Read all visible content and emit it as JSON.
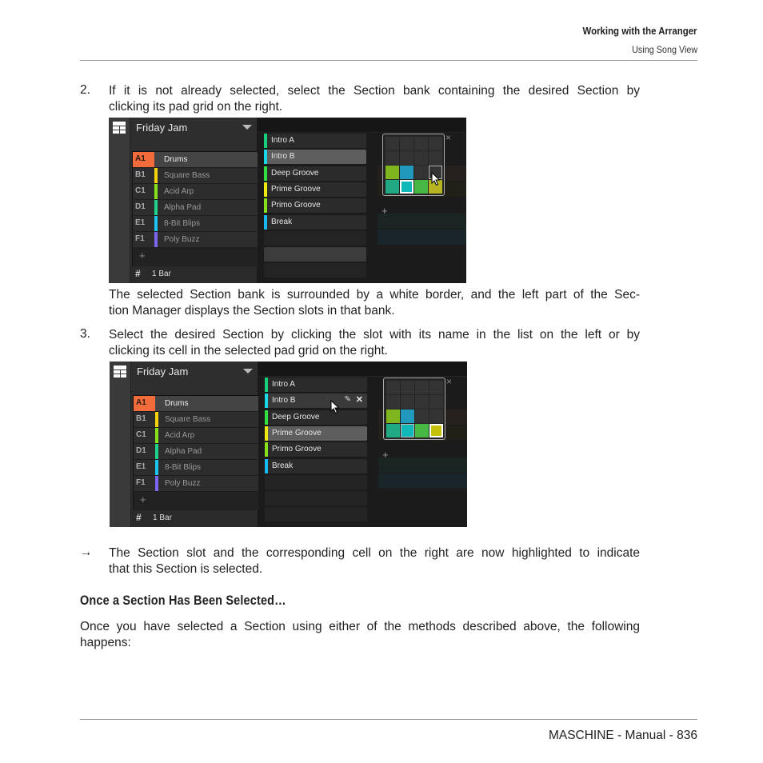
{
  "header": {
    "chapter": "Working with the Arranger",
    "section": "Using Song View"
  },
  "steps": [
    {
      "number": "2.",
      "lines": [
        "If it is not already selected, select the Section bank containing the desired Section by",
        "clicking its pad grid on the right."
      ]
    },
    {
      "number": "3.",
      "lines": [
        "Select the desired Section by clicking the slot with its name in the list on the left or by",
        "clicking its cell in the selected pad grid on the right."
      ]
    }
  ],
  "note_after_step2": [
    "The selected Section bank is surrounded by a white border, and the left part of the Sec-",
    "tion Manager displays the Section slots in that bank."
  ],
  "result": {
    "arrow": "→",
    "lines": [
      "The Section slot and the corresponding cell on the right are now highlighted to indicate",
      "that this Section is selected."
    ]
  },
  "subheading": "Once a Section Has Been Selected…",
  "closing": [
    "Once you have selected a Section using either of the methods described above, the following",
    "happens:"
  ],
  "footer": "MASCHINE - Manual - 836",
  "screenshots": [
    {
      "song_title": "Friday Jam",
      "bar_setting": "1 Bar",
      "add_label": "+",
      "groups": [
        {
          "id": "A1",
          "name": "Drums",
          "color": "#f26b3a",
          "selected": true
        },
        {
          "id": "B1",
          "name": "Square Bass",
          "color": "#f5d20a"
        },
        {
          "id": "C1",
          "name": "Acid Arp",
          "color": "#86e01a"
        },
        {
          "id": "D1",
          "name": "Alpha Pad",
          "color": "#1fd18a"
        },
        {
          "id": "E1",
          "name": "8-Bit Blips",
          "color": "#1cc4f0"
        },
        {
          "id": "F1",
          "name": "Poly Buzz",
          "color": "#7a66f0"
        }
      ],
      "sections": [
        {
          "name": "Intro A",
          "color": "#18d07a"
        },
        {
          "name": "Intro B",
          "color": "#18d8e8",
          "highlighted": true
        },
        {
          "name": "Deep Groove",
          "color": "#30e040"
        },
        {
          "name": "Prime Groove",
          "color": "#f0ea10"
        },
        {
          "name": "Primo Groove",
          "color": "#86e01a"
        },
        {
          "name": "Break",
          "color": "#18b8f0"
        }
      ],
      "pad_grid": {
        "rows": [
          [
            "#333333",
            "#333333",
            "#333333",
            "#333333"
          ],
          [
            "#333333",
            "#333333",
            "#333333",
            "#333333"
          ],
          [
            "#7fb61f",
            "#2199bc",
            "#333333",
            "#333333"
          ],
          [
            "#20a983",
            "#10b8b8",
            "#46b843",
            "#b6b421"
          ]
        ],
        "selected_cell": [
          3,
          1
        ],
        "hover_cell": [
          2,
          3
        ]
      },
      "close_icon": "×",
      "add_bank_icon": "+"
    },
    {
      "song_title": "Friday Jam",
      "bar_setting": "1 Bar",
      "add_label": "+",
      "groups": [
        {
          "id": "A1",
          "name": "Drums",
          "color": "#f26b3a",
          "selected": true
        },
        {
          "id": "B1",
          "name": "Square Bass",
          "color": "#f5d20a"
        },
        {
          "id": "C1",
          "name": "Acid Arp",
          "color": "#86e01a"
        },
        {
          "id": "D1",
          "name": "Alpha Pad",
          "color": "#1fd18a"
        },
        {
          "id": "E1",
          "name": "8-Bit Blips",
          "color": "#1cc4f0"
        },
        {
          "id": "F1",
          "name": "Poly Buzz",
          "color": "#7a66f0"
        }
      ],
      "sections": [
        {
          "name": "Intro A",
          "color": "#18d07a"
        },
        {
          "name": "Intro B",
          "color": "#18d8e8",
          "hover": true
        },
        {
          "name": "Deep Groove",
          "color": "#30e040"
        },
        {
          "name": "Prime Groove",
          "color": "#f0ea10",
          "highlighted": true
        },
        {
          "name": "Primo Groove",
          "color": "#86e01a"
        },
        {
          "name": "Break",
          "color": "#18b8f0"
        }
      ],
      "pad_grid": {
        "rows": [
          [
            "#333333",
            "#333333",
            "#333333",
            "#333333"
          ],
          [
            "#333333",
            "#333333",
            "#333333",
            "#333333"
          ],
          [
            "#7fb61f",
            "#2199bc",
            "#333333",
            "#333333"
          ],
          [
            "#20a983",
            "#10b8b8",
            "#46b843",
            "#c6c10a"
          ]
        ],
        "selected_cell": [
          3,
          3
        ],
        "dim_selected_cell": [
          3,
          1
        ]
      },
      "edit_icon": "✎",
      "delete_icon": "✕",
      "close_icon": "×",
      "add_bank_icon": "+"
    }
  ]
}
